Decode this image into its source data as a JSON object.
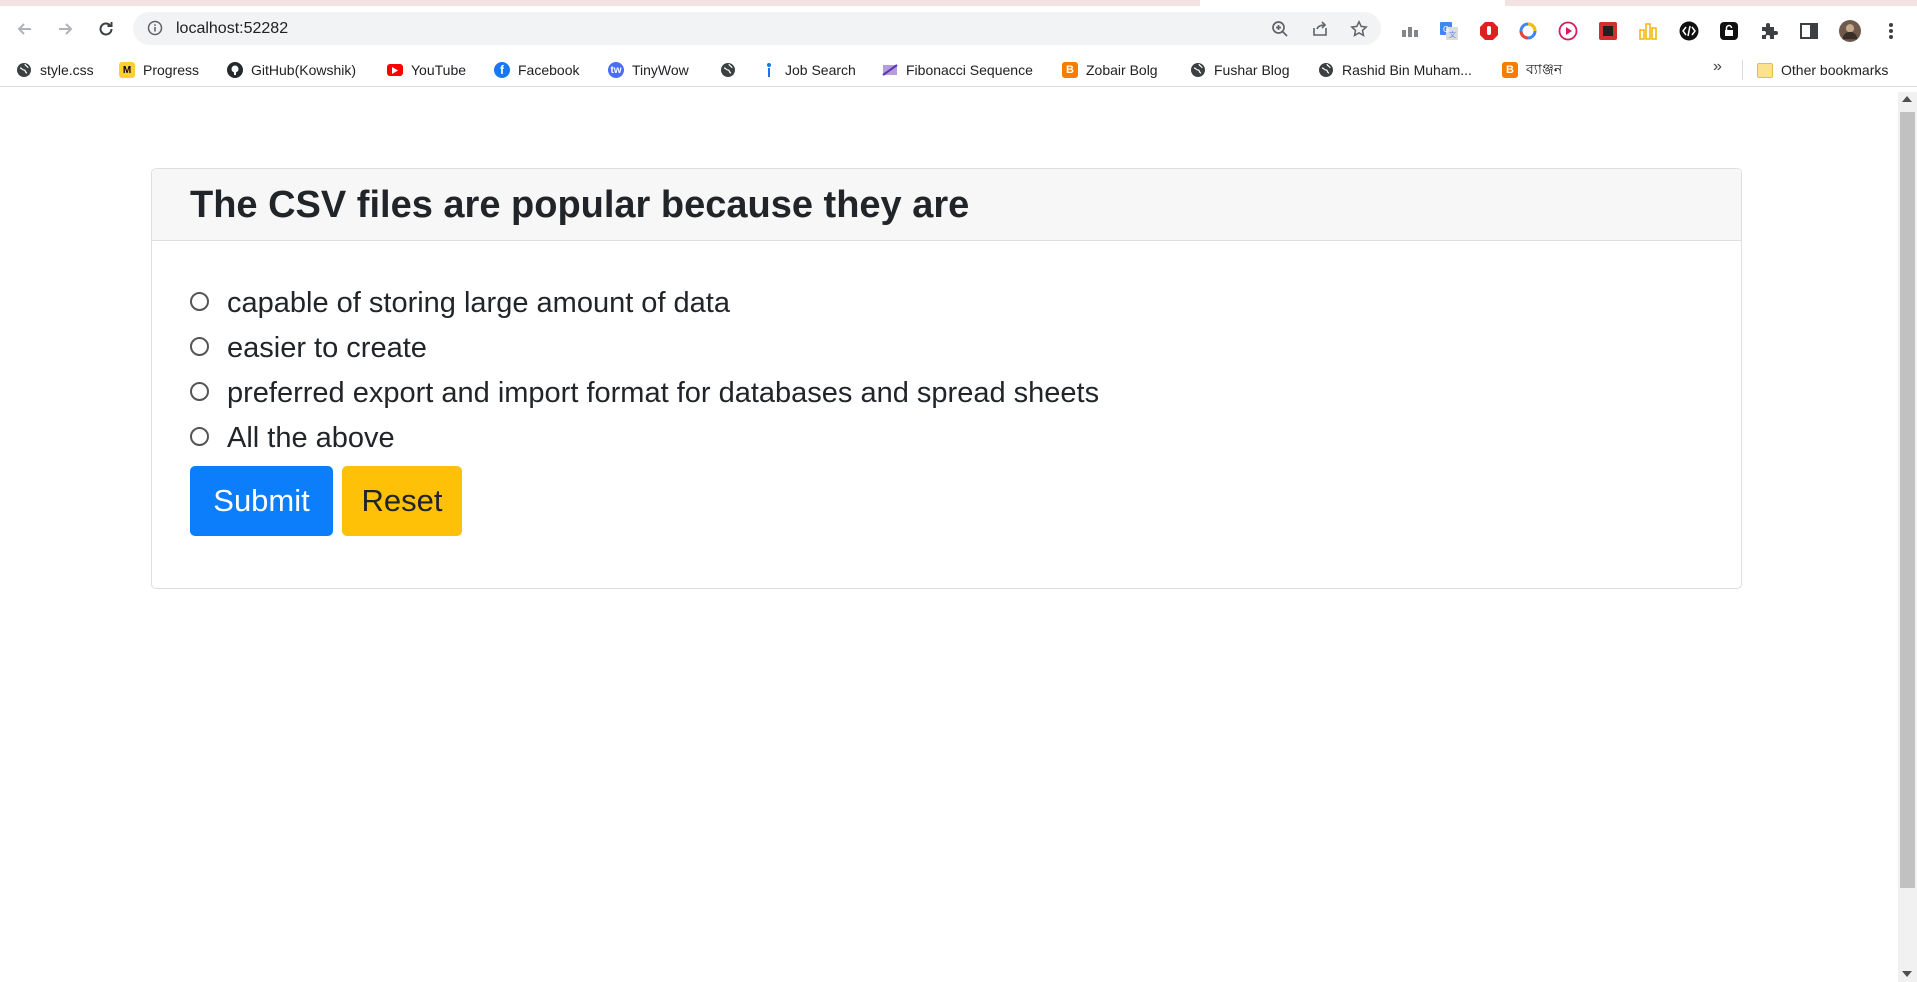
{
  "browser": {
    "url": "localhost:52282",
    "bookmarks": [
      {
        "label": "style.css",
        "icon": "globe-icon",
        "color": "#3c4043"
      },
      {
        "label": "Progress",
        "icon": "miro-icon",
        "color": "#ffd02f"
      },
      {
        "label": "GitHub(Kowshik)",
        "icon": "github-icon",
        "color": "#24292e"
      },
      {
        "label": "YouTube",
        "icon": "youtube-icon",
        "color": "#ff0000"
      },
      {
        "label": "Facebook",
        "icon": "facebook-icon",
        "color": "#1877f2"
      },
      {
        "label": "TinyWow",
        "icon": "tinywow-icon",
        "color": "#4a6cf7"
      },
      {
        "label": "",
        "icon": "globe-icon",
        "color": "#3c4043"
      },
      {
        "label": "Job Search",
        "icon": "job-search-icon",
        "color": "#1a73e8"
      },
      {
        "label": "Fibonacci Sequence",
        "icon": "fibonacci-icon",
        "color": "#8a6bbf"
      },
      {
        "label": "Zobair Bolg",
        "icon": "blogger-icon",
        "color": "#f57d00"
      },
      {
        "label": "Fushar Blog",
        "icon": "globe-icon",
        "color": "#3c4043"
      },
      {
        "label": "Rashid Bin Muham...",
        "icon": "globe-icon",
        "color": "#3c4043"
      },
      {
        "label": "ব্যাঞ্জন",
        "icon": "blogger-icon",
        "color": "#f57d00"
      }
    ],
    "more_bookmarks": "»",
    "other_bookmarks": "Other bookmarks"
  },
  "quiz": {
    "question": "The CSV files are popular because they are",
    "options": [
      "capable of storing large amount of data",
      "easier to create",
      "preferred export and import format for databases and spread sheets",
      "All the above"
    ],
    "submit_label": "Submit",
    "reset_label": "Reset"
  },
  "colors": {
    "submit": "#0d7efb",
    "reset": "#ffc107",
    "card_header": "#f7f7f7"
  }
}
